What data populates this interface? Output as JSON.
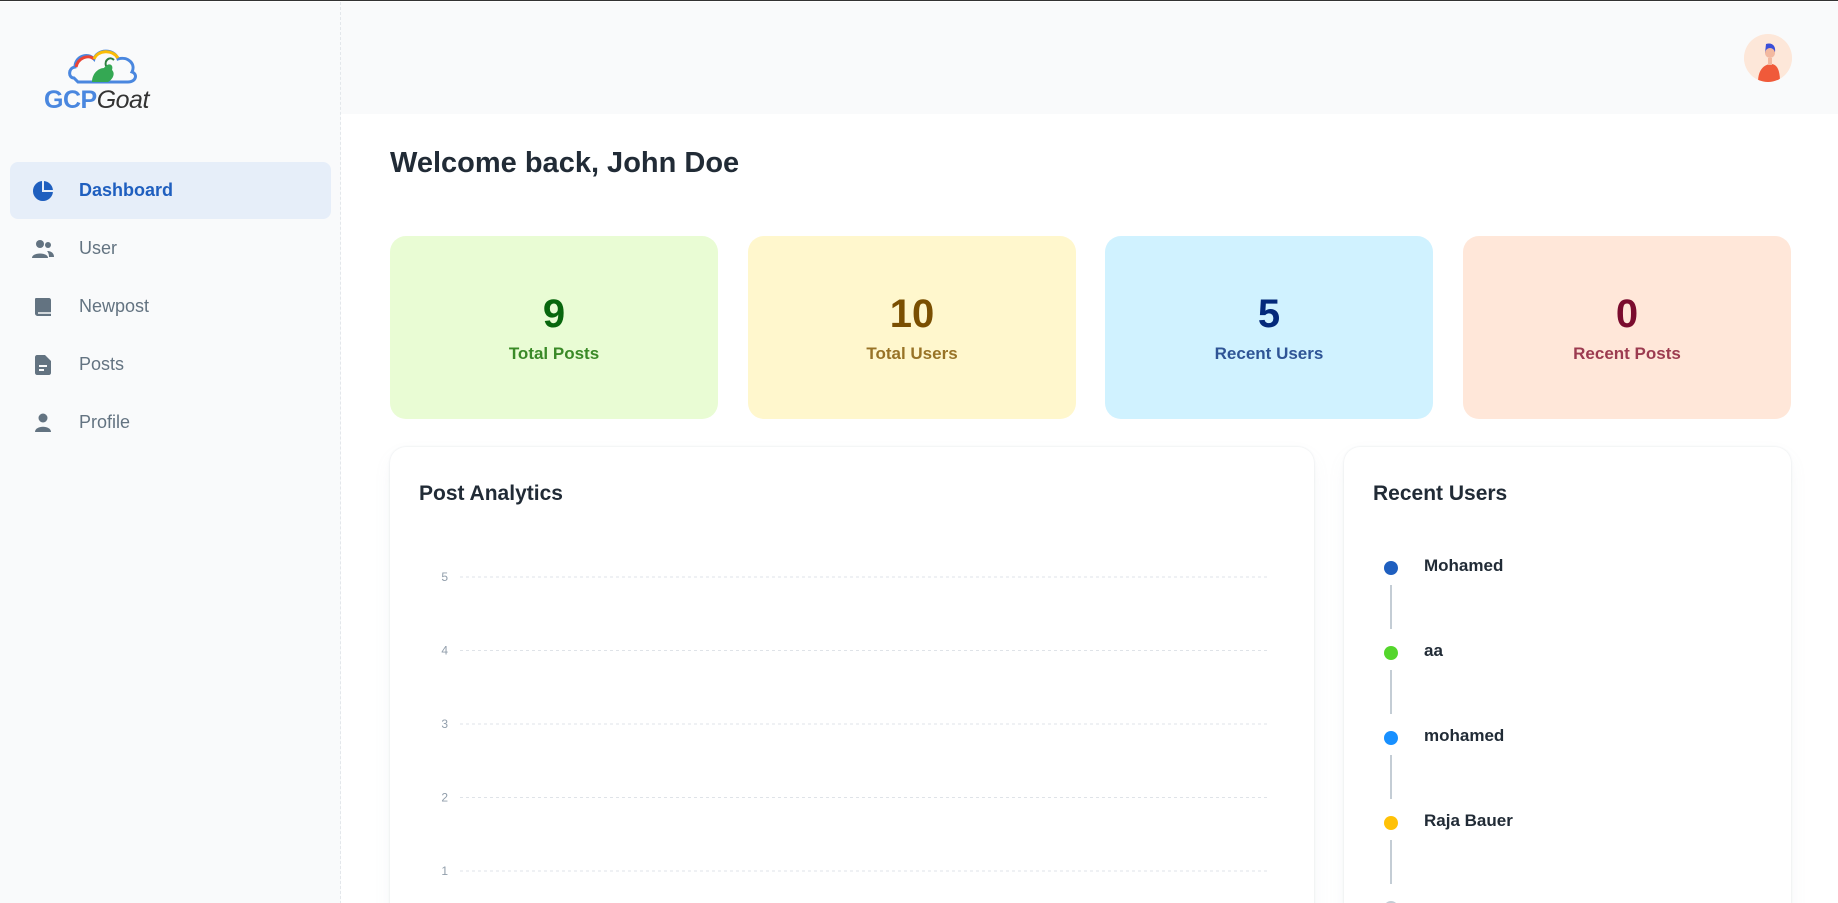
{
  "brand": {
    "part1": "GCP",
    "part2": "Goat"
  },
  "nav": {
    "items": [
      {
        "label": "Dashboard",
        "icon": "pie-chart-icon",
        "active": true
      },
      {
        "label": "User",
        "icon": "users-icon",
        "active": false
      },
      {
        "label": "Newpost",
        "icon": "book-icon",
        "active": false
      },
      {
        "label": "Posts",
        "icon": "file-text-icon",
        "active": false
      },
      {
        "label": "Profile",
        "icon": "person-icon",
        "active": false
      }
    ]
  },
  "header": {
    "avatar_icon": "user-avatar-icon"
  },
  "welcome": "Welcome back, John Doe",
  "stats": [
    {
      "value": "9",
      "label": "Total Posts",
      "bg": "#e9fcd4",
      "color": "#08660d",
      "label_color": "#3a8a27"
    },
    {
      "value": "10",
      "label": "Total Users",
      "bg": "#fff7cd",
      "color": "#7a4f01",
      "label_color": "#987326"
    },
    {
      "value": "5",
      "label": "Recent Users",
      "bg": "#d0f2ff",
      "color": "#04297a",
      "label_color": "#2f5596"
    },
    {
      "value": "0",
      "label": "Recent Posts",
      "bg": "#ffe7d9",
      "color": "#7a0c2e",
      "label_color": "#9c3b50"
    }
  ],
  "analytics": {
    "title": "Post Analytics",
    "chart_data": {
      "type": "line",
      "title": "Post Analytics",
      "y_ticks": [
        5,
        4,
        3,
        2,
        1
      ],
      "ylim": [
        1,
        5
      ],
      "grid": true,
      "series": []
    }
  },
  "recent_users": {
    "title": "Recent Users",
    "items": [
      {
        "name": "Mohamed",
        "color": "#1f5fbf"
      },
      {
        "name": "aa",
        "color": "#54d62c"
      },
      {
        "name": "mohamed",
        "color": "#1890ff"
      },
      {
        "name": "Raja Bauer",
        "color": "#ffc107"
      },
      {
        "name": "",
        "color": "#c4cdd5"
      }
    ]
  }
}
